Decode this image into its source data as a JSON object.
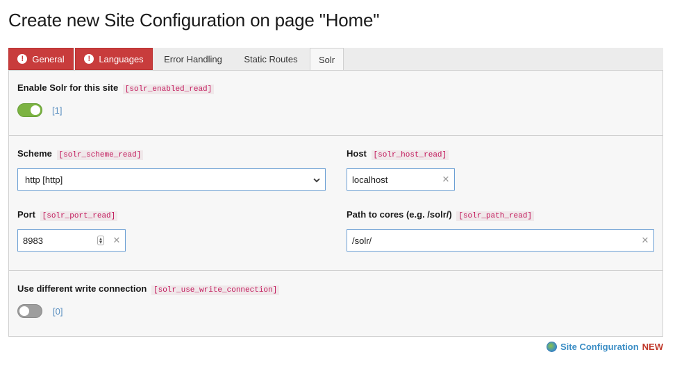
{
  "page": {
    "title": "Create new Site Configuration on page \"Home\""
  },
  "tabs": [
    {
      "label": "General",
      "state": "error"
    },
    {
      "label": "Languages",
      "state": "error"
    },
    {
      "label": "Error Handling",
      "state": "normal"
    },
    {
      "label": "Static Routes",
      "state": "normal"
    },
    {
      "label": "Solr",
      "state": "active"
    }
  ],
  "solr_enabled": {
    "label": "Enable Solr for this site",
    "code": "[solr_enabled_read]",
    "on": true,
    "value_text": "[1]"
  },
  "scheme": {
    "label": "Scheme",
    "code": "[solr_scheme_read]",
    "selected": "http [http]"
  },
  "host": {
    "label": "Host",
    "code": "[solr_host_read]",
    "value": "localhost"
  },
  "port": {
    "label": "Port",
    "code": "[solr_port_read]",
    "value": "8983"
  },
  "path": {
    "label": "Path to cores (e.g. /solr/)",
    "code": "[solr_path_read]",
    "value": "/solr/"
  },
  "write_connection": {
    "label": "Use different write connection",
    "code": "[solr_use_write_connection]",
    "on": false,
    "value_text": "[0]"
  },
  "footer": {
    "link": "Site Configuration",
    "badge": "NEW"
  },
  "colors": {
    "error_tab": "#c83c3c",
    "toggle_on": "#7cb342",
    "field_border": "#6b9fd4",
    "code_text": "#c2185b"
  }
}
